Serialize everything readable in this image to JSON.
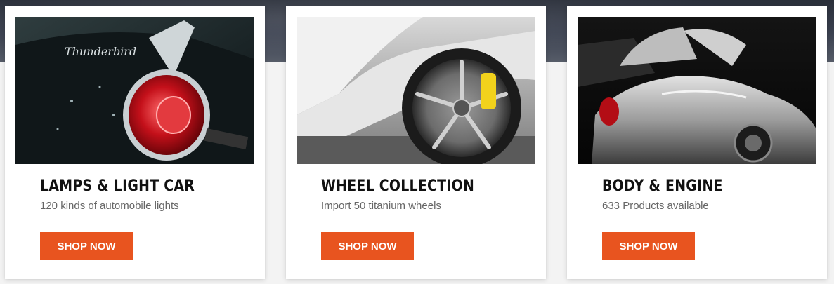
{
  "cards": [
    {
      "title": "LAMPS & LIGHT CAR",
      "subtitle": "120 kinds of automobile lights",
      "button": "SHOP NOW",
      "image": "tail-light-photo"
    },
    {
      "title": "WHEEL COLLECTION",
      "subtitle": "Import 50 titanium wheels",
      "button": "SHOP NOW",
      "image": "wheel-photo"
    },
    {
      "title": "BODY & ENGINE",
      "subtitle": "633 Products available",
      "button": "SHOP NOW",
      "image": "classic-car-photo"
    }
  ],
  "colors": {
    "accent": "#e8541f",
    "card_bg": "#ffffff",
    "page_bg": "#f3f3f3",
    "title": "#111111",
    "subtitle": "#666666"
  }
}
